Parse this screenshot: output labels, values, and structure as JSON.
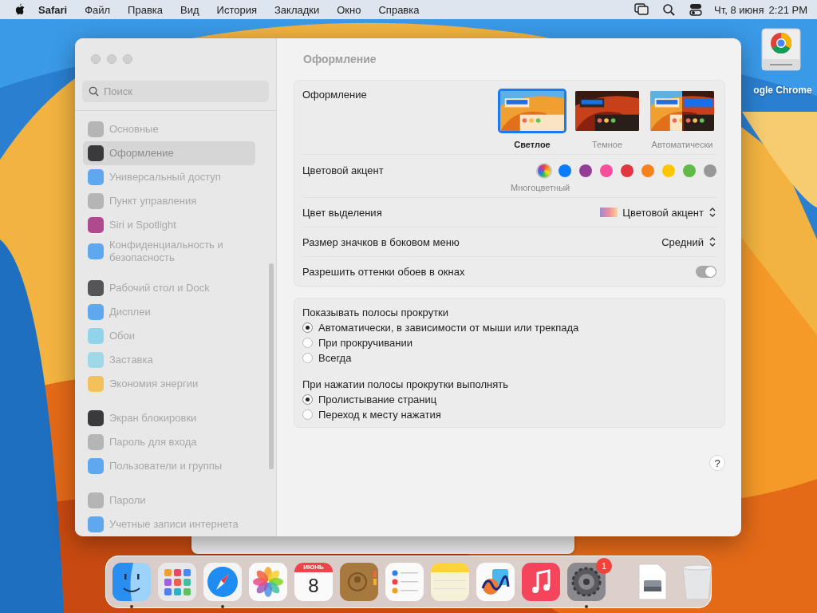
{
  "menubar": {
    "app": "Safari",
    "menus": [
      "Файл",
      "Правка",
      "Вид",
      "История",
      "Закладки",
      "Окно",
      "Справка"
    ],
    "date": "Чт, 8 июня",
    "time": "2:21 PM"
  },
  "desktop_icon": {
    "label": "ogle Chrome"
  },
  "window": {
    "title": "Оформление",
    "search": {
      "placeholder": "Поиск"
    },
    "sidebar": [
      [
        {
          "label": "Основные",
          "selected": false,
          "color": "#b5b5b5"
        },
        {
          "label": "Оформление",
          "selected": true,
          "color": "#3a3a3c"
        },
        {
          "label": "Универсальный доступ",
          "selected": false,
          "color": "#5fa8f0"
        },
        {
          "label": "Пункт управления",
          "selected": false,
          "color": "#b5b5b5"
        },
        {
          "label": "Siri и Spotlight",
          "selected": false,
          "color": "#b04a8e"
        },
        {
          "label": "Конфиденциальность и безопасность",
          "selected": false,
          "color": "#5fa8f0"
        }
      ],
      [
        {
          "label": "Рабочий стол и Dock",
          "selected": false,
          "color": "#555558"
        },
        {
          "label": "Дисплеи",
          "selected": false,
          "color": "#5fa8f0"
        },
        {
          "label": "Обои",
          "selected": false,
          "color": "#8fd4e8"
        },
        {
          "label": "Заставка",
          "selected": false,
          "color": "#9fd8e8"
        },
        {
          "label": "Экономия энергии",
          "selected": false,
          "color": "#f3c15a"
        }
      ],
      [
        {
          "label": "Экран блокировки",
          "selected": false,
          "color": "#3a3a3c"
        },
        {
          "label": "Пароль для входа",
          "selected": false,
          "color": "#b5b5b5"
        },
        {
          "label": "Пользователи и группы",
          "selected": false,
          "color": "#5fa8f0"
        }
      ],
      [
        {
          "label": "Пароли",
          "selected": false,
          "color": "#b5b5b5"
        },
        {
          "label": "Учетные записи интернета",
          "selected": false,
          "color": "#5fa8f0"
        }
      ]
    ],
    "appearance": {
      "label": "Оформление",
      "options": [
        {
          "label": "Светлое",
          "kind": "light",
          "selected": true
        },
        {
          "label": "Темное",
          "kind": "dark",
          "selected": false
        },
        {
          "label": "Автоматически",
          "kind": "auto",
          "selected": false
        }
      ]
    },
    "accent": {
      "label": "Цветовой акцент",
      "caption": "Многоцветный",
      "colors": [
        {
          "kind": "multicolor",
          "selected": true
        },
        {
          "kind": "solid",
          "color": "#0a7aff",
          "selected": false
        },
        {
          "kind": "solid",
          "color": "#953d96",
          "selected": false
        },
        {
          "kind": "solid",
          "color": "#f74f9e",
          "selected": false
        },
        {
          "kind": "solid",
          "color": "#e0383e",
          "selected": false
        },
        {
          "kind": "solid",
          "color": "#f7821b",
          "selected": false
        },
        {
          "kind": "solid",
          "color": "#ffc600",
          "selected": false
        },
        {
          "kind": "solid",
          "color": "#62ba46",
          "selected": false
        },
        {
          "kind": "solid",
          "color": "#989898",
          "selected": false
        }
      ]
    },
    "highlight": {
      "label": "Цвет выделения",
      "value": "Цветовой акцент"
    },
    "icon_size": {
      "label": "Размер значков в боковом меню",
      "value": "Средний"
    },
    "tinting": {
      "label": "Разрешить оттенки обоев в окнах",
      "on": true
    },
    "scroll_groups": [
      {
        "title": "Показывать полосы прокрутки",
        "options": [
          {
            "label": "Автоматически, в зависимости от мыши или трекпада",
            "selected": true
          },
          {
            "label": "При прокручивании",
            "selected": false
          },
          {
            "label": "Всегда",
            "selected": false
          }
        ]
      },
      {
        "title": "При нажатии полосы прокрутки выполнять",
        "options": [
          {
            "label": "Пролистывание страниц",
            "selected": true
          },
          {
            "label": "Переход к месту нажатия",
            "selected": false
          }
        ]
      }
    ],
    "help": "?"
  },
  "dock": [
    {
      "kind": "finder",
      "running": true
    },
    {
      "kind": "launchpad",
      "running": false
    },
    {
      "kind": "safari",
      "running": true
    },
    {
      "kind": "photos",
      "running": false
    },
    {
      "kind": "calendar",
      "running": false,
      "month": "ИЮНЬ",
      "day": "8"
    },
    {
      "kind": "contacts",
      "running": false
    },
    {
      "kind": "reminders",
      "running": false
    },
    {
      "kind": "notes",
      "running": false
    },
    {
      "kind": "freeform",
      "running": false
    },
    {
      "kind": "music",
      "running": false
    },
    {
      "kind": "settings",
      "running": true,
      "badge": "1"
    },
    {
      "kind": "separator"
    },
    {
      "kind": "drive",
      "running": false
    },
    {
      "kind": "trash",
      "running": false
    }
  ]
}
